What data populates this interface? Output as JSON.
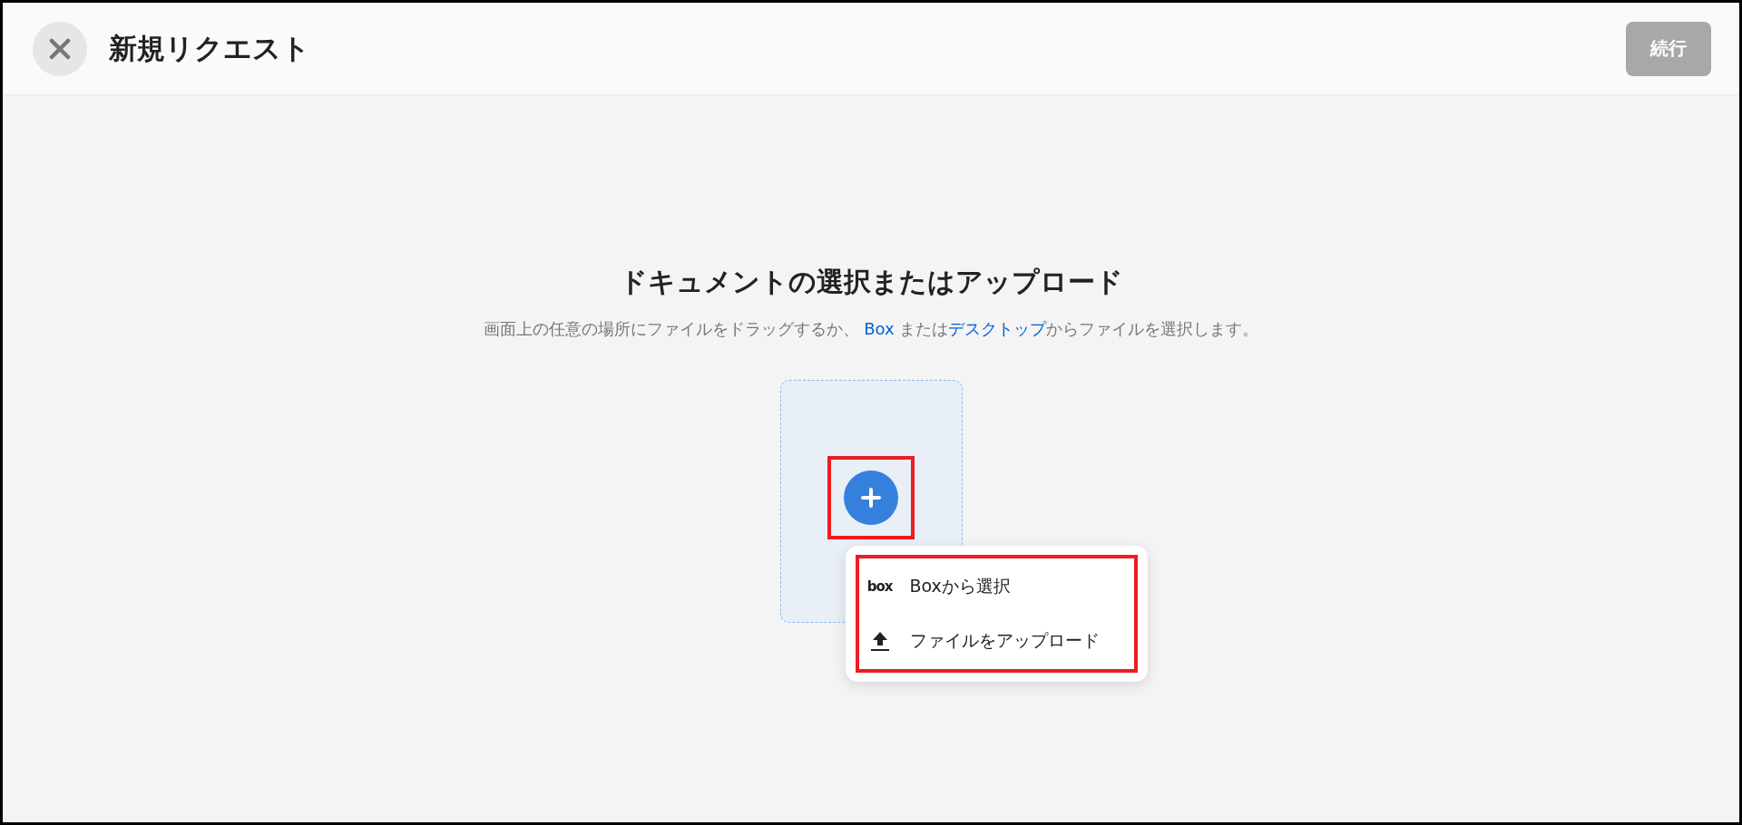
{
  "header": {
    "title": "新規リクエスト",
    "continue_button": {
      "label": "続行",
      "disabled": true
    }
  },
  "main": {
    "heading": "ドキュメントの選択またはアップロード",
    "description": [
      {
        "kind": "text",
        "text": "画面上の任意の場所にファイルをドラッグするか、 "
      },
      {
        "kind": "link",
        "text": "Box"
      },
      {
        "kind": "text",
        "text": " または"
      },
      {
        "kind": "link",
        "text": "デスクトップ"
      },
      {
        "kind": "text",
        "text": "からファイルを選択します。"
      }
    ]
  },
  "add_menu": {
    "items": [
      {
        "kind": "box",
        "logo": "box",
        "label": "Boxから選択"
      },
      {
        "kind": "upload",
        "label": "ファイルをアップロード"
      }
    ]
  }
}
